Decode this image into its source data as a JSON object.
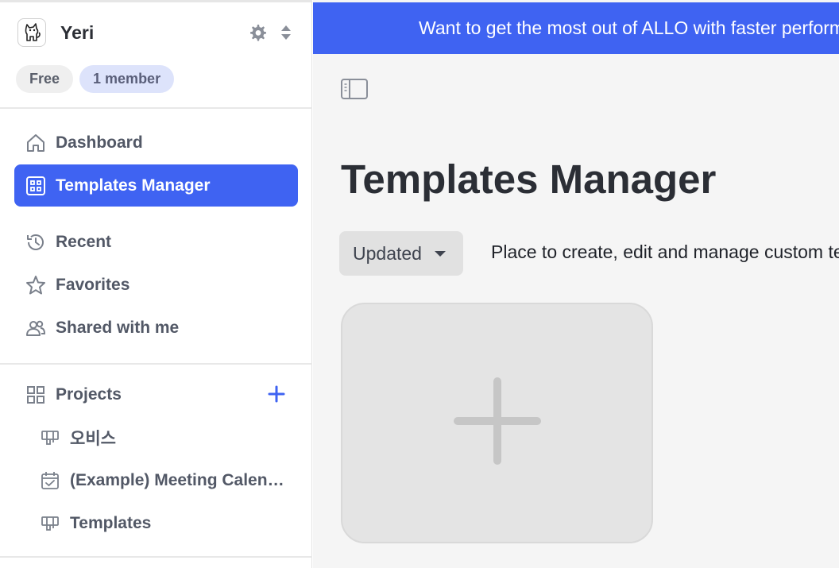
{
  "workspace": {
    "name": "Yeri",
    "logo_icon": "cat-logo-icon"
  },
  "badges": {
    "plan": "Free",
    "members": "1 member"
  },
  "nav": {
    "items": [
      {
        "label": "Dashboard",
        "icon": "home-icon"
      },
      {
        "label": "Templates Manager",
        "icon": "grid-icon",
        "active": true
      },
      {
        "label": "Recent",
        "icon": "history-icon"
      },
      {
        "label": "Favorites",
        "icon": "star-icon"
      },
      {
        "label": "Shared with me",
        "icon": "users-icon"
      }
    ]
  },
  "projects": {
    "header": "Projects",
    "items": [
      {
        "label": "오비스",
        "icon": "board-icon"
      },
      {
        "label": "(Example) Meeting Calendar",
        "icon": "calendar-check-icon"
      },
      {
        "label": "Templates",
        "icon": "board-icon"
      }
    ]
  },
  "banner": {
    "text": "Want to get the most out of ALLO with faster performance?"
  },
  "main": {
    "title": "Templates Manager",
    "sort_label": "Updated",
    "description": "Place to create, edit and manage custom templates."
  },
  "colors": {
    "accent": "#3f63f2",
    "member_badge": "#dde3fb",
    "main_bg": "#f5f5f5"
  }
}
